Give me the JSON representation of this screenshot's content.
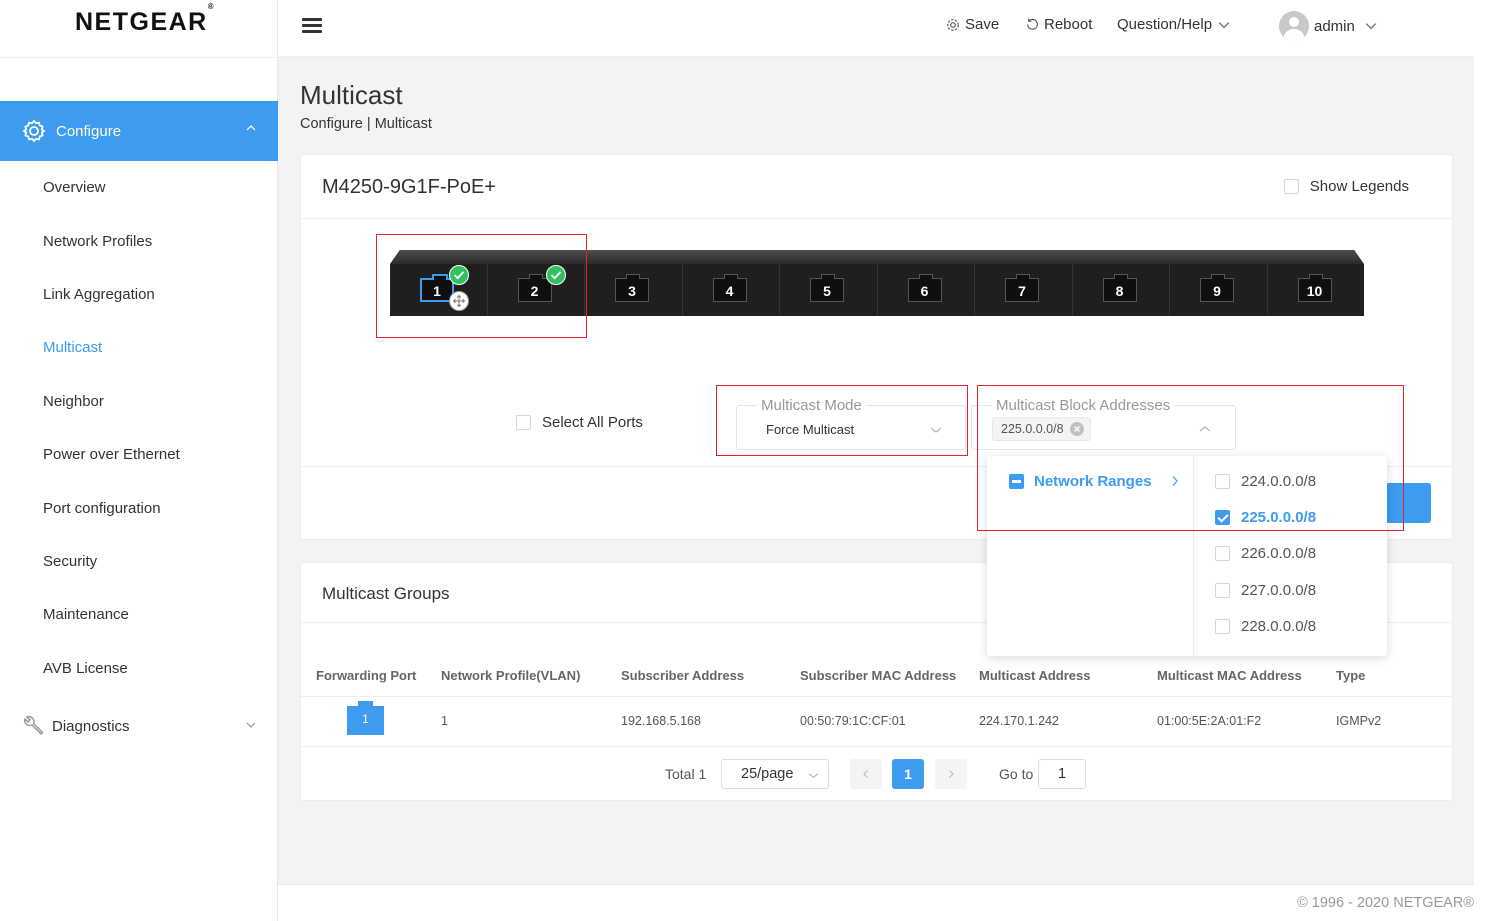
{
  "brand": {
    "logo": "NETGEAR",
    "logo_mark": "®"
  },
  "header": {
    "save_label": "Save",
    "reboot_label": "Reboot",
    "help_label": "Question/Help",
    "user_label": "admin"
  },
  "sidebar": {
    "configure_label": "Configure",
    "items": [
      {
        "label": "Overview"
      },
      {
        "label": "Network Profiles"
      },
      {
        "label": "Link Aggregation"
      },
      {
        "label": "Multicast"
      },
      {
        "label": "Neighbor"
      },
      {
        "label": "Power over Ethernet"
      },
      {
        "label": "Port configuration"
      },
      {
        "label": "Security"
      },
      {
        "label": "Maintenance"
      },
      {
        "label": "AVB License"
      }
    ],
    "diagnostics_label": "Diagnostics",
    "active_item": "Multicast"
  },
  "page": {
    "title": "Multicast",
    "breadcrumb": "Configure | Multicast"
  },
  "device": {
    "name": "M4250-9G1F-PoE+",
    "show_legends_label": "Show Legends",
    "ports": [
      "1",
      "2",
      "3",
      "4",
      "5",
      "6",
      "7",
      "8",
      "9",
      "10"
    ],
    "checked_ports": [
      "1",
      "2"
    ],
    "selected_port": "1"
  },
  "form": {
    "select_all_label": "Select All Ports",
    "mode_label": "Multicast Mode",
    "mode_value": "Force Multicast",
    "block_label": "Multicast Block Addresses",
    "block_chip": "225.0.0.0/8"
  },
  "dropdown": {
    "group_label": "Network Ranges",
    "options": [
      {
        "label": "224.0.0.0/8",
        "checked": false
      },
      {
        "label": "225.0.0.0/8",
        "checked": true
      },
      {
        "label": "226.0.0.0/8",
        "checked": false
      },
      {
        "label": "227.0.0.0/8",
        "checked": false
      },
      {
        "label": "228.0.0.0/8",
        "checked": false
      }
    ]
  },
  "groups": {
    "title": "Multicast Groups",
    "columns": [
      "Forwarding Port",
      "Network Profile(VLAN)",
      "Subscriber Address",
      "Subscriber MAC Address",
      "Multicast Address",
      "Multicast MAC Address",
      "Type"
    ],
    "rows": [
      {
        "port": "1",
        "vlan": "1",
        "subscriber": "192.168.5.168",
        "sub_mac": "00:50:79:1C:CF:01",
        "mcast": "224.170.1.242",
        "mcast_mac": "01:00:5E:2A:01:F2",
        "type": "IGMPv2"
      }
    ]
  },
  "pagination": {
    "total": "Total 1",
    "page_size": "25/page",
    "current_page": "1",
    "goto_label": "Go to",
    "goto_value": "1"
  },
  "footer": {
    "copyright": "© 1996 - 2020 NETGEAR®"
  },
  "colors": {
    "accent": "#3d9bf0",
    "check": "#31c25e",
    "highlight": "#e0242a"
  }
}
